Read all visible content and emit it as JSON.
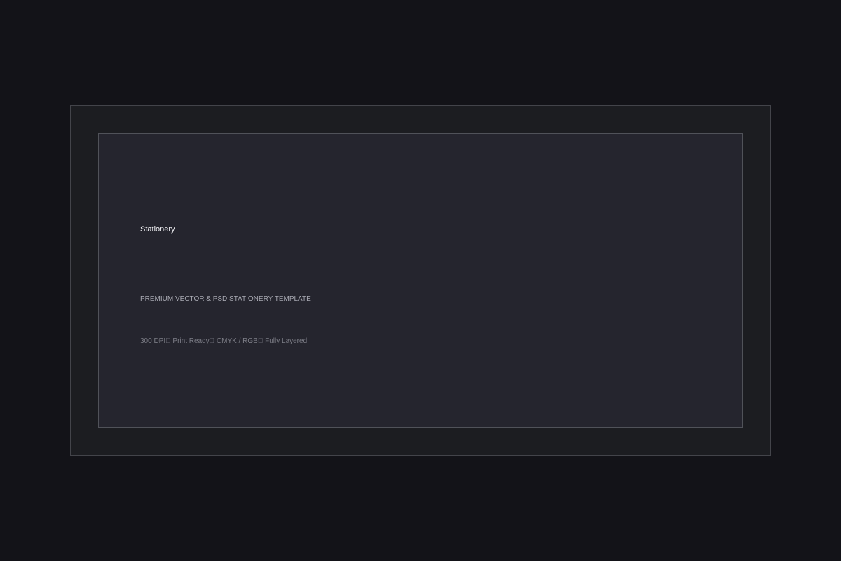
{
  "card": {
    "title": "Stationery",
    "subtitle": "PREMIUM VECTOR & PSD STATIONERY TEMPLATE",
    "meta": "300 DPI￿ Print Ready￿ CMYK / RGB￿ Fully Layered"
  },
  "colors": {
    "page_background": "#131318",
    "outer_frame_background": "#1c1d21",
    "outer_frame_border": "#43444a",
    "inner_panel_background": "#25252e",
    "inner_panel_border": "#505259",
    "title_text": "#f4f4f7",
    "subtitle_text": "#a7a8b1",
    "meta_text": "#7c7d86"
  }
}
